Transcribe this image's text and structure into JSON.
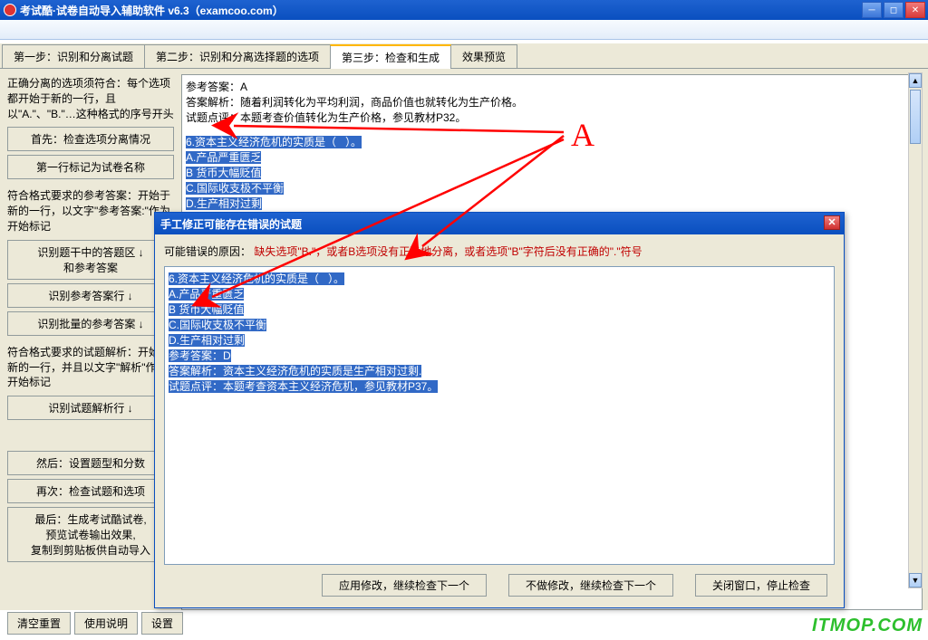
{
  "window": {
    "title": "考试酷·试卷自动导入辅助软件 v6.3（examcoo.com）"
  },
  "tabs": {
    "t1": "第一步：识别和分离试题",
    "t2": "第二步：识别和分离选择题的选项",
    "t3": "第三步：检查和生成",
    "t4": "效果预览"
  },
  "sidebar": {
    "desc1": "正确分离的选项须符合：每个选项都开始于新的一行，且以\"A.\"、\"B.\"…这种格式的序号开头",
    "btn1": "首先：检查选项分离情况",
    "btn2": "第一行标记为试卷名称",
    "desc2": "符合格式要求的参考答案：开始于新的一行，以文字\"参考答案:\"作为开始标记",
    "btn3": "识别题干中的答题区 ↓\n和参考答案",
    "btn4": "识别参考答案行 ↓",
    "btn5": "识别批量的参考答案 ↓",
    "desc3": "符合格式要求的试题解析：开始于新的一行，并且以文字\"解析\"作为开始标记",
    "btn6": "识别试题解析行 ↓",
    "btn7": "然后：设置题型和分数",
    "btn8": "再次：检查试题和选项",
    "btn9": "最后：生成考试酷试卷,\n预览试卷输出效果,\n复制到剪贴板供自动导入"
  },
  "content": {
    "l1": "参考答案：A",
    "l2": "答案解析：随着利润转化为平均利润，商品价值也就转化为生产价格。",
    "l3": "试题点评：本题考查价值转化为生产价格，参见教材P32。",
    "h1": "6.资本主义经济危机的实质是（   ）。",
    "h2": "A.产品严重匮乏",
    "h3": "B 货币大幅贬值",
    "h4": "C.国际收支极不平衡",
    "h5": "D.生产相对过剩",
    "h6": "参考答案：D",
    "h7": "答案解析：资本主义经济危机的实质是生产相对过剩.",
    "h8": "试题点评：本题考查资本主义经济危机，参见教材P37。"
  },
  "dialog": {
    "title": "手工修正可能存在错误的试题",
    "reason_label": "可能错误的原因：",
    "reason_text": "缺失选项\"B.\"，或者B选项没有正确地分离，或者选项\"B\"字符后没有正确的\".\"符号",
    "c1": "6.资本主义经济危机的实质是（   ）。",
    "c2": "A.产品严重匮乏",
    "c3": "B 货币大幅贬值",
    "c4": "C.国际收支极不平衡",
    "c5": "D.生产相对过剩",
    "c6": "参考答案：D",
    "c7": "答案解析：资本主义经济危机的实质是生产相对过剩.",
    "c8": "试题点评：本题考查资本主义经济危机，参见教材P37。",
    "btn_apply": "应用修改，继续检查下一个",
    "btn_skip": "不做修改，继续检查下一个",
    "btn_close": "关闭窗口，停止检查"
  },
  "bottom": {
    "b1": "清空重置",
    "b2": "使用说明",
    "b3": "设置"
  },
  "annotation": {
    "letter": "A"
  },
  "watermark": "ITMOP.COM"
}
